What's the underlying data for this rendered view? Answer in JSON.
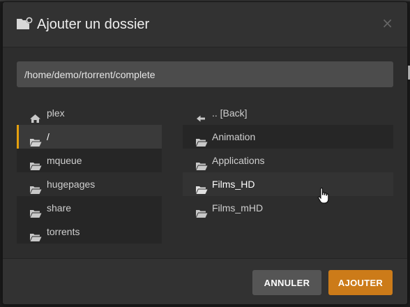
{
  "dialog": {
    "title": "Ajouter un dossier",
    "close_symbol": "×",
    "path_value": "/home/demo/rtorrent/complete",
    "accent_color": "#e5a00d"
  },
  "left_list": [
    {
      "label": "plex",
      "icon": "home-icon"
    },
    {
      "label": "/",
      "icon": "folder-open-icon",
      "selected": true
    },
    {
      "label": "mqueue",
      "icon": "folder-open-icon"
    },
    {
      "label": "hugepages",
      "icon": "folder-open-icon"
    },
    {
      "label": "share",
      "icon": "folder-open-icon"
    },
    {
      "label": "torrents",
      "icon": "folder-open-icon"
    }
  ],
  "right_list": [
    {
      "label": ".. [Back]",
      "icon": "arrow-left-icon"
    },
    {
      "label": "Animation",
      "icon": "folder-open-icon"
    },
    {
      "label": "Applications",
      "icon": "folder-open-icon"
    },
    {
      "label": "Films_HD",
      "icon": "folder-open-icon",
      "hovered": true
    },
    {
      "label": "Films_mHD",
      "icon": "folder-open-icon"
    }
  ],
  "footer": {
    "cancel_label": "ANNULER",
    "add_label": "AJOUTER",
    "add_color": "#cc7b19"
  }
}
